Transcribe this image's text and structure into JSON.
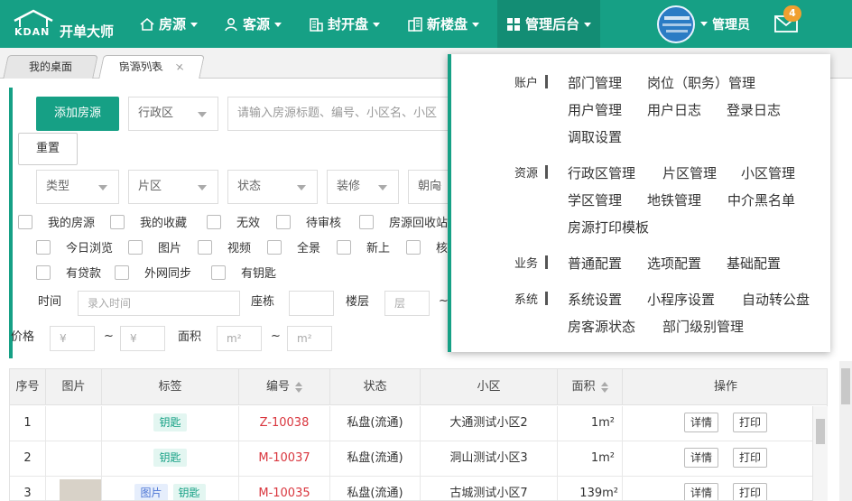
{
  "brand": {
    "name": "开单大师",
    "logo_text": "KDAN"
  },
  "nav": [
    {
      "label": "房源",
      "icon": "home-icon"
    },
    {
      "label": "客源",
      "icon": "user-icon"
    },
    {
      "label": "封开盘",
      "icon": "building-icon"
    },
    {
      "label": "新楼盘",
      "icon": "city-icon"
    },
    {
      "label": "管理后台",
      "icon": "grid-icon"
    }
  ],
  "user": {
    "name": "管理员",
    "avatar_text": "",
    "mail_count": "4"
  },
  "tabs": [
    {
      "label": "我的桌面"
    },
    {
      "label": "房源列表",
      "close": "×"
    }
  ],
  "filters": {
    "add_button": "添加房源",
    "reset_button": "重置",
    "district": "行政区",
    "search_placeholder": "请输入房源标题、编号、小区名、小区",
    "type": "类型",
    "area": "片区",
    "status": "状态",
    "decoration": "装修",
    "orientation": "朝向",
    "checks_row1": [
      "我的房源",
      "我的收藏",
      "无效",
      "待审核",
      "房源回收站"
    ],
    "checks_row2": [
      "今日浏览",
      "图片",
      "视频",
      "全景",
      "新上",
      "核"
    ],
    "checks_row3": [
      "有贷款",
      "外网同步",
      "有钥匙"
    ],
    "time_label": "时间",
    "time_placeholder": "录入时间",
    "building_label": "座栋",
    "floor_label": "楼层",
    "floor_placeholder": "层",
    "tilde": "~",
    "price_label": "价格",
    "price_placeholder": "¥",
    "size_label": "面积",
    "size_placeholder": "m²"
  },
  "table": {
    "headers": [
      "序号",
      "图片",
      "标签",
      "编号",
      "状态",
      "小区",
      "面积",
      "操作"
    ],
    "rows": [
      {
        "no": "1",
        "tags": [
          "钥匙"
        ],
        "code": "Z-10038",
        "status": "私盘(流通)",
        "community": "大通测试小区2",
        "size": "1m²",
        "actions": [
          "详情",
          "打印"
        ]
      },
      {
        "no": "2",
        "tags": [
          "钥匙"
        ],
        "code": "M-10037",
        "status": "私盘(流通)",
        "community": "洞山测试小区3",
        "size": "1m²",
        "actions": [
          "详情",
          "打印"
        ]
      },
      {
        "no": "3",
        "tags": [
          "图片",
          "钥匙"
        ],
        "code": "M-10035",
        "status": "私盘(流通)",
        "community": "古城测试小区7",
        "size": "139m²",
        "actions": [
          "详情",
          "打印"
        ]
      }
    ]
  },
  "admin_menu": [
    {
      "group": "账户",
      "items": [
        [
          "部门管理",
          "岗位（职务）管理"
        ],
        [
          "用户管理",
          "用户日志",
          "登录日志"
        ],
        [
          "调取设置"
        ]
      ]
    },
    {
      "group": "资源",
      "items": [
        [
          "行政区管理",
          "片区管理",
          "小区管理"
        ],
        [
          "学区管理",
          "地铁管理",
          "中介黑名单"
        ],
        [
          "房源打印模板"
        ]
      ]
    },
    {
      "group": "业务",
      "items": [
        [
          "普通配置",
          "选项配置",
          "基础配置"
        ]
      ]
    },
    {
      "group": "系统",
      "items": [
        [
          "系统设置",
          "小程序设置",
          "自动转公盘"
        ],
        [
          "房客源状态",
          "部门级别管理"
        ]
      ]
    }
  ],
  "colors": {
    "brand": "#16a085",
    "code": "#d9363e"
  }
}
